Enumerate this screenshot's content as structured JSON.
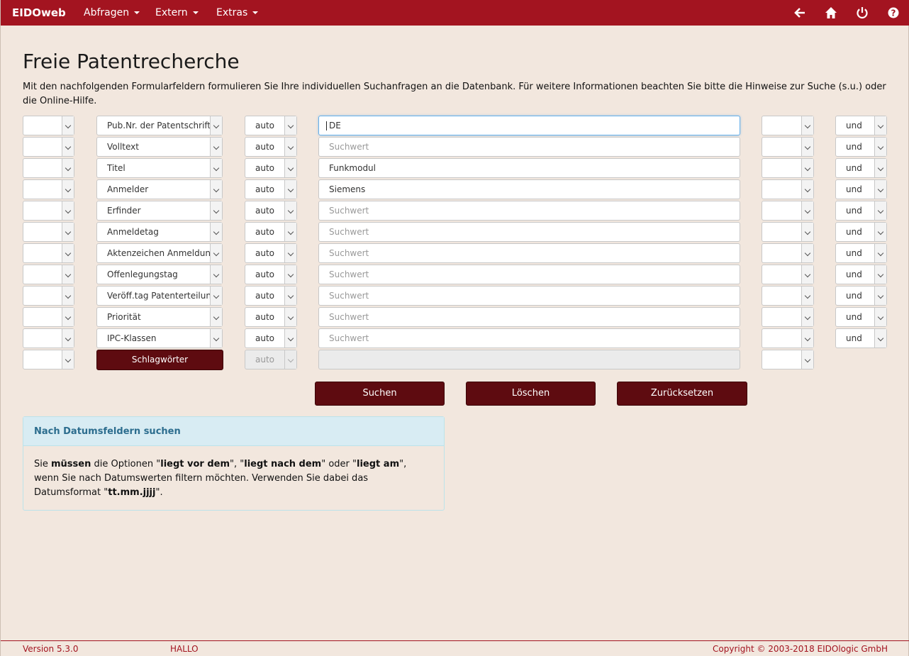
{
  "navbar": {
    "brand": "EIDOweb",
    "menus": [
      {
        "label": "Abfragen"
      },
      {
        "label": "Extern"
      },
      {
        "label": "Extras"
      }
    ],
    "icons": [
      "back-arrow-icon",
      "home-icon",
      "power-icon",
      "help-icon"
    ],
    "color": "#a31420"
  },
  "page": {
    "title": "Freie Patentrecherche",
    "intro": "Mit den nachfolgenden Formularfeldern formulieren Sie Ihre individuellen Suchanfragen an die Datenbank. Für weitere Informationen beachten Sie bitte die Hinweise zur Suche (s.u.) oder die Online-Hilfe."
  },
  "rows": [
    {
      "field": "Pub.Nr. der Patentschrift",
      "mode": "auto",
      "value": "DE",
      "placeholder": "Suchwert",
      "op": "und"
    },
    {
      "field": "Volltext",
      "mode": "auto",
      "value": "",
      "placeholder": "Suchwert",
      "op": "und"
    },
    {
      "field": "Titel",
      "mode": "auto",
      "value": "Funkmodul",
      "placeholder": "Suchwert",
      "op": "und"
    },
    {
      "field": "Anmelder",
      "mode": "auto",
      "value": "Siemens",
      "placeholder": "Suchwert",
      "op": "und"
    },
    {
      "field": "Erfinder",
      "mode": "auto",
      "value": "",
      "placeholder": "Suchwert",
      "op": "und"
    },
    {
      "field": "Anmeldetag",
      "mode": "auto",
      "value": "",
      "placeholder": "Suchwert",
      "op": "und"
    },
    {
      "field": "Aktenzeichen Anmeldung",
      "mode": "auto",
      "value": "",
      "placeholder": "Suchwert",
      "op": "und"
    },
    {
      "field": "Offenlegungstag",
      "mode": "auto",
      "value": "",
      "placeholder": "Suchwert",
      "op": "und"
    },
    {
      "field": "Veröff.tag Patenterteilung",
      "mode": "auto",
      "value": "",
      "placeholder": "Suchwert",
      "op": "und"
    },
    {
      "field": "Priorität",
      "mode": "auto",
      "value": "",
      "placeholder": "Suchwert",
      "op": "und"
    },
    {
      "field": "IPC-Klassen",
      "mode": "auto",
      "value": "",
      "placeholder": "Suchwert",
      "op": "und"
    }
  ],
  "keyword_row": {
    "button": "Schlagwörter",
    "mode": "auto"
  },
  "actions": {
    "search": "Suchen",
    "clear": "Löschen",
    "reset": "Zurücksetzen"
  },
  "info": {
    "heading": "Nach Datumsfeldern suchen",
    "p1": "Sie ",
    "b1": "müssen",
    "p2": " die Optionen \"",
    "b2": "liegt vor dem",
    "p3": "\", \"",
    "b3": "liegt nach dem",
    "p4": "\" oder \"",
    "b4": "liegt am",
    "p5": "\", wenn Sie nach Datumswerten filtern möchten. Verwenden Sie dabei das Datumsformat \"",
    "b5": "tt.mm.jjjj",
    "p6": "\"."
  },
  "footer": {
    "version": "Version 5.3.0",
    "user": "HALLO",
    "copyright": "Copyright © 2003-2018 EIDOlogic GmbH"
  }
}
